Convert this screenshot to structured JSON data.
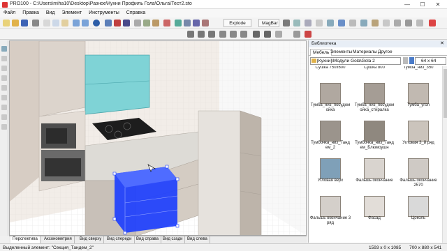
{
  "window": {
    "title": "PRO100 - C:\\Users\\miha10\\Desktop\\Разное\\Кухни Профиль Гола\\Ольга\\Тест2.sto",
    "minimize": "—",
    "maximize": "☐",
    "close": "✕"
  },
  "menu": [
    "Файл",
    "Правка",
    "Вид",
    "Элемент",
    "Инструменты",
    "Справка"
  ],
  "toolbar": {
    "explode_label": "Explode",
    "magbar_label": "MagBar"
  },
  "view_tabs": [
    "Перспектива",
    "Аксонометрия",
    "Вид сверху",
    "Вид спереди",
    "Вид справа",
    "Вид сзади",
    "Вид слева"
  ],
  "status": {
    "selected": "Выделенный элемент: \"Секция_Тандем_2\"",
    "coords": "1593 x 0 x 1085",
    "size": "700 x 880 x 541"
  },
  "library": {
    "title": "Библиотека",
    "tabs": [
      "Мебель",
      "Элементы",
      "Материалы",
      "Другое"
    ],
    "path": "[Кухни]\\Модули Gola\\Gola 2",
    "thumb_size": "64 x 64",
    "items": [
      {
        "label": "Сушка 750x600"
      },
      {
        "label": "Сушка 800"
      },
      {
        "label": "Тумба_низ_350"
      },
      {
        "label": "Тумба_низ_посудом ойка"
      },
      {
        "label": "Тумба_низ_посудом ойка_стиралка"
      },
      {
        "label": "Тумба_угол"
      },
      {
        "label": "Тумбочка_низ_Танд ем_2"
      },
      {
        "label": "Тумбочка_низ_Танд ем_Блюмоушн"
      },
      {
        "label": "Угловая 3_й ряд"
      },
      {
        "label": "Угловая верх"
      },
      {
        "label": "Фальшь окончание"
      },
      {
        "label": "Фальшь окончание 2570"
      },
      {
        "label": "Фальшь окончание 3 ряд"
      },
      {
        "label": "Фасад"
      },
      {
        "label": "Цоколь"
      }
    ]
  },
  "colors": {
    "accent": "#1a3cff",
    "glass": "#7fd3d6",
    "wall": "#e8ded6",
    "counter": "#dddbd6",
    "cabinet": "#c8c0b8"
  }
}
